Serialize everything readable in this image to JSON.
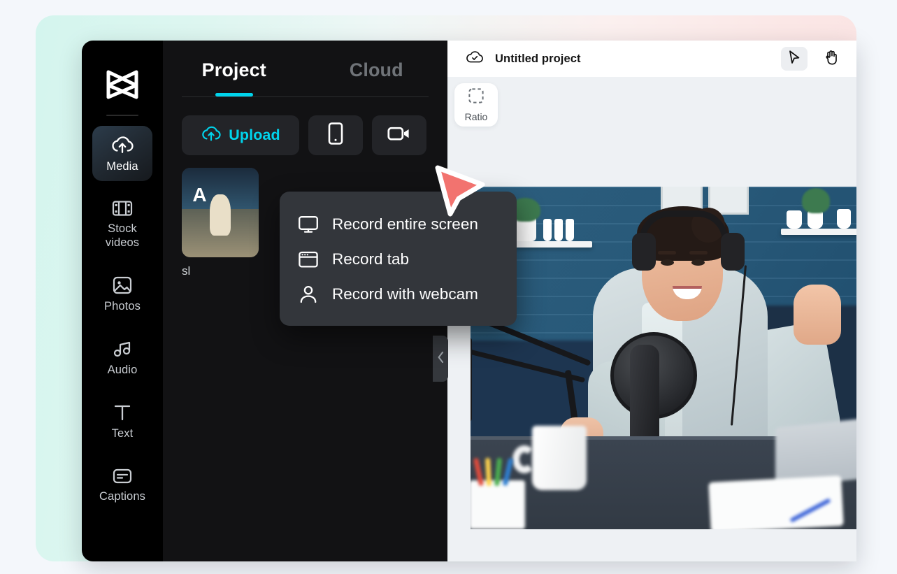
{
  "app": {
    "logo_icon": "capcut-logo-icon"
  },
  "rail": {
    "items": [
      {
        "label": "Media",
        "icon": "cloud-upload-icon",
        "active": true
      },
      {
        "label": "Stock videos",
        "icon": "film-strip-icon",
        "active": false
      },
      {
        "label": "Photos",
        "icon": "image-icon",
        "active": false
      },
      {
        "label": "Audio",
        "icon": "music-notes-icon",
        "active": false
      },
      {
        "label": "Text",
        "icon": "text-t-icon",
        "active": false
      },
      {
        "label": "Captions",
        "icon": "captions-icon",
        "active": false
      }
    ]
  },
  "media_panel": {
    "tabs": [
      {
        "label": "Project",
        "active": true
      },
      {
        "label": "Cloud",
        "active": false
      }
    ],
    "upload_label": "Upload",
    "upload_icon": "cloud-upload-icon",
    "from_device_icon": "phone-icon",
    "record_icon": "video-camera-icon",
    "collapse_icon": "chevron-left-icon",
    "media_items": [
      {
        "caption": "sl",
        "thumb_label": "A"
      }
    ]
  },
  "record_menu": {
    "items": [
      {
        "label": "Record entire screen",
        "icon": "monitor-icon"
      },
      {
        "label": "Record tab",
        "icon": "browser-window-icon"
      },
      {
        "label": "Record with webcam",
        "icon": "person-icon"
      }
    ]
  },
  "topbar": {
    "cloud_status_icon": "cloud-check-icon",
    "project_title": "Untitled project",
    "tools": [
      {
        "name": "select",
        "icon": "cursor-arrow-icon",
        "active": true
      },
      {
        "name": "pan",
        "icon": "hand-icon",
        "active": false
      }
    ]
  },
  "canvas": {
    "ratio_label": "Ratio",
    "ratio_icon": "crop-dashed-icon",
    "preview_alt": "Woman with headphones speaking into a studio microphone in a blue wood-panelled podcast room"
  },
  "cursor": {
    "icon": "arrow-pointer-highlight-icon",
    "color": "#f2736f"
  },
  "theme": {
    "accent": "#00d4ec",
    "rail_bg": "#000000",
    "panel_bg": "#121214",
    "menu_bg": "#33363b",
    "editor_bg": "#eef1f4",
    "page_bg": "#f4f7fb",
    "card_gradient_start": "#d4f5ee",
    "card_gradient_end": "#fae2e2"
  }
}
